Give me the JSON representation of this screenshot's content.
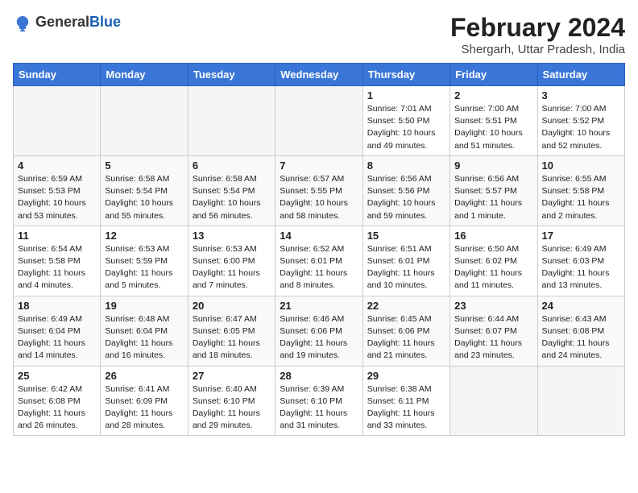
{
  "header": {
    "logo_general": "General",
    "logo_blue": "Blue",
    "month_year": "February 2024",
    "location": "Shergarh, Uttar Pradesh, India"
  },
  "days_of_week": [
    "Sunday",
    "Monday",
    "Tuesday",
    "Wednesday",
    "Thursday",
    "Friday",
    "Saturday"
  ],
  "weeks": [
    [
      {
        "day": "",
        "info": ""
      },
      {
        "day": "",
        "info": ""
      },
      {
        "day": "",
        "info": ""
      },
      {
        "day": "",
        "info": ""
      },
      {
        "day": "1",
        "info": "Sunrise: 7:01 AM\nSunset: 5:50 PM\nDaylight: 10 hours\nand 49 minutes."
      },
      {
        "day": "2",
        "info": "Sunrise: 7:00 AM\nSunset: 5:51 PM\nDaylight: 10 hours\nand 51 minutes."
      },
      {
        "day": "3",
        "info": "Sunrise: 7:00 AM\nSunset: 5:52 PM\nDaylight: 10 hours\nand 52 minutes."
      }
    ],
    [
      {
        "day": "4",
        "info": "Sunrise: 6:59 AM\nSunset: 5:53 PM\nDaylight: 10 hours\nand 53 minutes."
      },
      {
        "day": "5",
        "info": "Sunrise: 6:58 AM\nSunset: 5:54 PM\nDaylight: 10 hours\nand 55 minutes."
      },
      {
        "day": "6",
        "info": "Sunrise: 6:58 AM\nSunset: 5:54 PM\nDaylight: 10 hours\nand 56 minutes."
      },
      {
        "day": "7",
        "info": "Sunrise: 6:57 AM\nSunset: 5:55 PM\nDaylight: 10 hours\nand 58 minutes."
      },
      {
        "day": "8",
        "info": "Sunrise: 6:56 AM\nSunset: 5:56 PM\nDaylight: 10 hours\nand 59 minutes."
      },
      {
        "day": "9",
        "info": "Sunrise: 6:56 AM\nSunset: 5:57 PM\nDaylight: 11 hours\nand 1 minute."
      },
      {
        "day": "10",
        "info": "Sunrise: 6:55 AM\nSunset: 5:58 PM\nDaylight: 11 hours\nand 2 minutes."
      }
    ],
    [
      {
        "day": "11",
        "info": "Sunrise: 6:54 AM\nSunset: 5:58 PM\nDaylight: 11 hours\nand 4 minutes."
      },
      {
        "day": "12",
        "info": "Sunrise: 6:53 AM\nSunset: 5:59 PM\nDaylight: 11 hours\nand 5 minutes."
      },
      {
        "day": "13",
        "info": "Sunrise: 6:53 AM\nSunset: 6:00 PM\nDaylight: 11 hours\nand 7 minutes."
      },
      {
        "day": "14",
        "info": "Sunrise: 6:52 AM\nSunset: 6:01 PM\nDaylight: 11 hours\nand 8 minutes."
      },
      {
        "day": "15",
        "info": "Sunrise: 6:51 AM\nSunset: 6:01 PM\nDaylight: 11 hours\nand 10 minutes."
      },
      {
        "day": "16",
        "info": "Sunrise: 6:50 AM\nSunset: 6:02 PM\nDaylight: 11 hours\nand 11 minutes."
      },
      {
        "day": "17",
        "info": "Sunrise: 6:49 AM\nSunset: 6:03 PM\nDaylight: 11 hours\nand 13 minutes."
      }
    ],
    [
      {
        "day": "18",
        "info": "Sunrise: 6:49 AM\nSunset: 6:04 PM\nDaylight: 11 hours\nand 14 minutes."
      },
      {
        "day": "19",
        "info": "Sunrise: 6:48 AM\nSunset: 6:04 PM\nDaylight: 11 hours\nand 16 minutes."
      },
      {
        "day": "20",
        "info": "Sunrise: 6:47 AM\nSunset: 6:05 PM\nDaylight: 11 hours\nand 18 minutes."
      },
      {
        "day": "21",
        "info": "Sunrise: 6:46 AM\nSunset: 6:06 PM\nDaylight: 11 hours\nand 19 minutes."
      },
      {
        "day": "22",
        "info": "Sunrise: 6:45 AM\nSunset: 6:06 PM\nDaylight: 11 hours\nand 21 minutes."
      },
      {
        "day": "23",
        "info": "Sunrise: 6:44 AM\nSunset: 6:07 PM\nDaylight: 11 hours\nand 23 minutes."
      },
      {
        "day": "24",
        "info": "Sunrise: 6:43 AM\nSunset: 6:08 PM\nDaylight: 11 hours\nand 24 minutes."
      }
    ],
    [
      {
        "day": "25",
        "info": "Sunrise: 6:42 AM\nSunset: 6:08 PM\nDaylight: 11 hours\nand 26 minutes."
      },
      {
        "day": "26",
        "info": "Sunrise: 6:41 AM\nSunset: 6:09 PM\nDaylight: 11 hours\nand 28 minutes."
      },
      {
        "day": "27",
        "info": "Sunrise: 6:40 AM\nSunset: 6:10 PM\nDaylight: 11 hours\nand 29 minutes."
      },
      {
        "day": "28",
        "info": "Sunrise: 6:39 AM\nSunset: 6:10 PM\nDaylight: 11 hours\nand 31 minutes."
      },
      {
        "day": "29",
        "info": "Sunrise: 6:38 AM\nSunset: 6:11 PM\nDaylight: 11 hours\nand 33 minutes."
      },
      {
        "day": "",
        "info": ""
      },
      {
        "day": "",
        "info": ""
      }
    ]
  ]
}
